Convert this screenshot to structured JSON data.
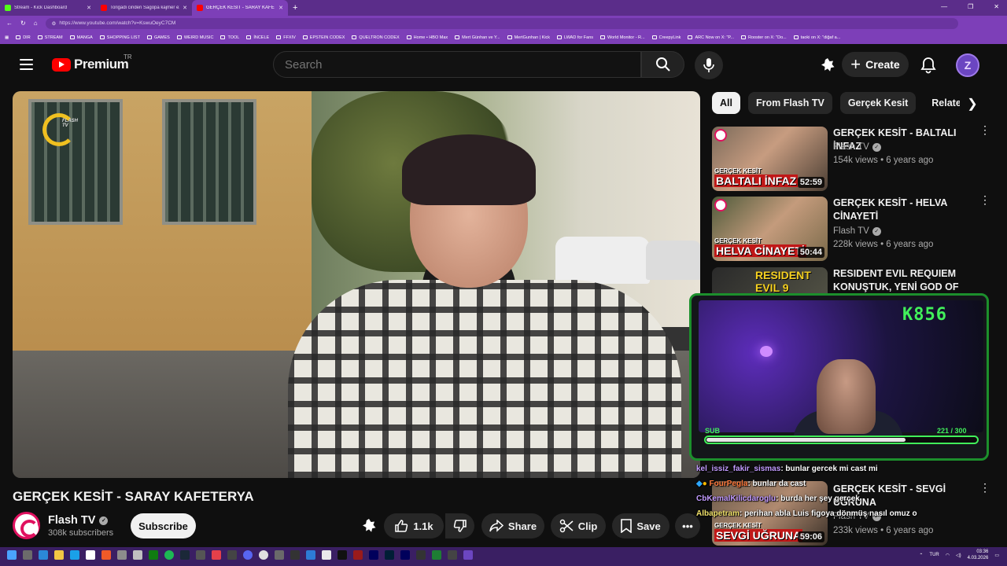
{
  "browser": {
    "tabs": [
      {
        "title": "Stream - Kick Dashboard",
        "color": "#53fc18"
      },
      {
        "title": "Torigadi cinderi Sagopa kajmer ez",
        "color": "#ff0000"
      },
      {
        "title": "GERÇEK KESİT - SARAY KAFETE",
        "color": "#ff0000"
      }
    ],
    "url": "https://www.youtube.com/watch?v=KswuOeyC7CM",
    "bookmarks": [
      "DIR",
      "STREAM",
      "MANGA",
      "SHOPPING LIST",
      "GAMES",
      "WEIRD MUSIC",
      "TOOL",
      "İNCELE",
      "FFXIV",
      "EPSTEIN CODEX",
      "QUELTRON CODEX",
      "Home • HBO Max",
      "Mert Günhan ve Y...",
      "MertGunhan | Kick",
      "LWAD for Fans",
      "World Monitor - R...",
      "CreepyLink",
      "ARC Now on X: \"P...",
      "Rooster on X: \"Do...",
      "taoki on X: \"diğaf a..."
    ]
  },
  "youtube": {
    "logo_word": "Premium",
    "country": "TR",
    "search_placeholder": "Search",
    "create_label": "Create",
    "avatar_letter": "Z"
  },
  "video": {
    "title": "GERÇEK KESİT - SARAY KAFETERYA",
    "watermark": "FLASH TV",
    "channel": "Flash TV",
    "subscribers": "308k subscribers",
    "subscribe_label": "Subscribe",
    "likes": "1.1k",
    "share_label": "Share",
    "clip_label": "Clip",
    "save_label": "Save"
  },
  "chips": [
    "All",
    "From Flash TV",
    "Gerçek Kesit",
    "Related"
  ],
  "recommendations": [
    {
      "title": "GERÇEK KESİT - BALTALI İNFAZ",
      "channel": "Flash TV",
      "meta": "154k views • 6 years ago",
      "duration": "52:59",
      "thumb_small": "GERÇEK KESİT",
      "thumb_big": "BALTALI İNFAZ"
    },
    {
      "title": "GERÇEK KESİT - HELVA CİNAYETİ",
      "channel": "Flash TV",
      "meta": "228k views • 6 years ago",
      "duration": "50:44",
      "thumb_small": "GERÇEK KESİT",
      "thumb_big": "HELVA CİNAYETİ"
    },
    {
      "title": "RESIDENT EVIL REQUIEM KONUŞTUK, YENİ GOD OF WA...",
      "thumb_big": "RESIDENT EVIL 9"
    },
    {
      "title": "GERÇEK KESİT - SEVGİ UĞRUNA",
      "channel": "Flash TV",
      "meta": "233k views • 6 years ago",
      "duration": "59:06",
      "thumb_small": "GERÇEK KESİT",
      "thumb_big": "SEVGİ UĞRUNA"
    }
  ],
  "kick_overlay": {
    "count": "K856",
    "sub_label": "SUB",
    "progress_text": "221  / 300",
    "progress_fraction": 0.737,
    "accent": "#41f05a"
  },
  "chat": [
    {
      "user": "kel_issiz_fakir_sismas",
      "msg": ": bunlar gercek mi cast mi"
    },
    {
      "user": "FourPegla",
      "msg": ": bunlar da cast"
    },
    {
      "user": "CbKemalKilicdaroglu",
      "msg": ": burda her şey gerçek"
    },
    {
      "user": "Albapetram",
      "msg": ": perihan abla Luis figoya dönmüş nasıl omuz o"
    }
  ],
  "taskbar": {
    "lang": "TUR",
    "time": "03:36",
    "date": "4.03.2026"
  }
}
